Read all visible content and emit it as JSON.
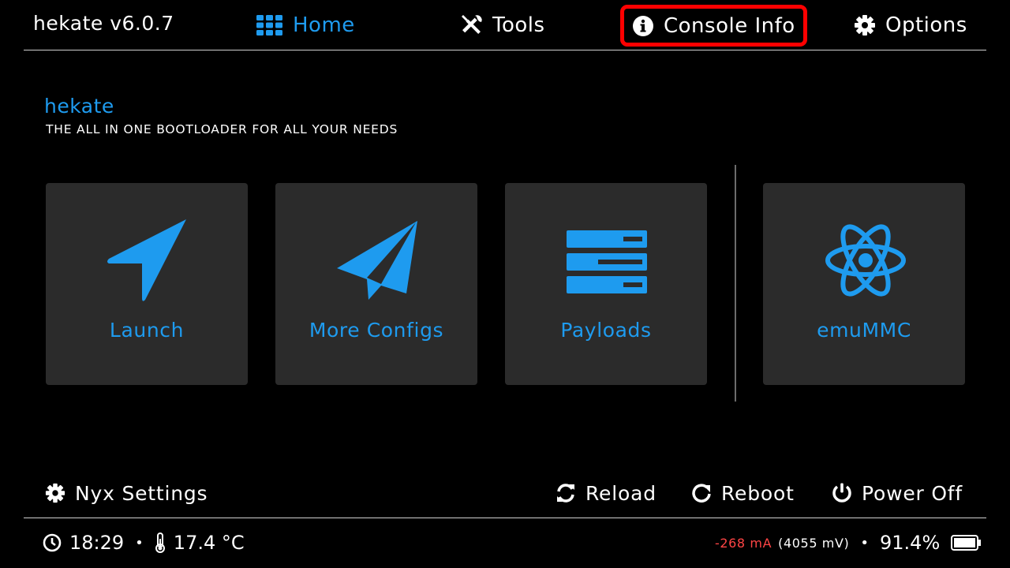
{
  "topbar": {
    "version": "hekate v6.0.7",
    "tabs": [
      {
        "label": "Home",
        "icon": "grid-icon",
        "active": true
      },
      {
        "label": "Tools",
        "icon": "tools-icon",
        "active": false
      },
      {
        "label": "Console Info",
        "icon": "info-icon",
        "active": false,
        "highlighted": true
      },
      {
        "label": "Options",
        "icon": "gear-icon",
        "active": false
      }
    ]
  },
  "header": {
    "title": "hekate",
    "subtitle": "THE ALL IN ONE BOOTLOADER FOR ALL YOUR NEEDS"
  },
  "tiles": [
    {
      "label": "Launch",
      "icon": "navigation-arrow-icon"
    },
    {
      "label": "More Configs",
      "icon": "paper-plane-icon"
    },
    {
      "label": "Payloads",
      "icon": "server-list-icon"
    },
    {
      "label": "emuMMC",
      "icon": "atom-icon"
    }
  ],
  "actions": {
    "nyx_settings": "Nyx Settings",
    "reload": "Reload",
    "reboot": "Reboot",
    "power_off": "Power Off"
  },
  "status": {
    "time": "18:29",
    "separator": "•",
    "temperature": "17.4 °C",
    "current": "-268 mA",
    "voltage": "(4055 mV)",
    "battery": "91.4%"
  },
  "colors": {
    "accent": "#1e9bef",
    "highlight_border": "#ff0000",
    "tile_bg": "#2b2b2b",
    "current_text": "#ff4545"
  }
}
